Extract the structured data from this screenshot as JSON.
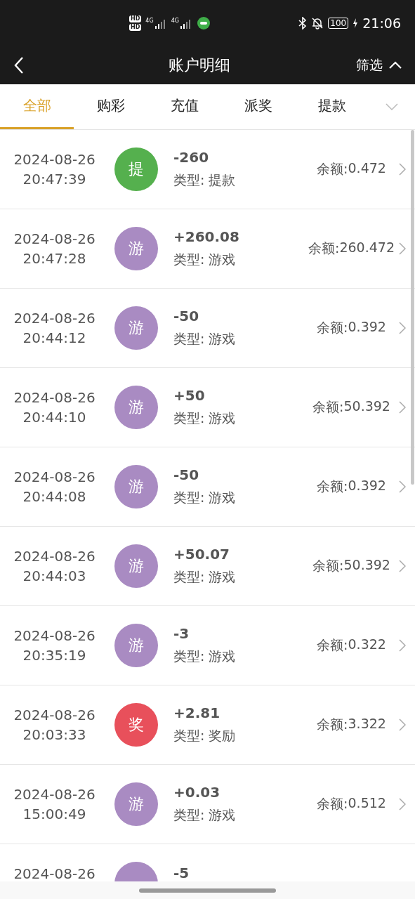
{
  "status_bar": {
    "sims": [
      "HD",
      "HD"
    ],
    "networks": [
      "4G",
      "4G"
    ],
    "battery": "100",
    "time": "21:06"
  },
  "header": {
    "title": "账户明细",
    "filter": "筛选",
    "filter_expanded": true
  },
  "tabs": [
    {
      "label": "全部",
      "selected": true
    },
    {
      "label": "购彩",
      "selected": false
    },
    {
      "label": "充值",
      "selected": false
    },
    {
      "label": "派奖",
      "selected": false
    },
    {
      "label": "提款",
      "selected": false
    }
  ],
  "records": [
    {
      "date": "2024-08-26",
      "time": "20:47:39",
      "badge": "提",
      "color": "#55b04e",
      "amount": "-260",
      "type": "类型: 提款",
      "balance_label": "余额:",
      "balance": "0.472"
    },
    {
      "date": "2024-08-26",
      "time": "20:47:28",
      "badge": "游",
      "color": "#a98bc2",
      "amount": "+260.08",
      "type": "类型: 游戏",
      "balance_label": "余额:",
      "balance": "260.472"
    },
    {
      "date": "2024-08-26",
      "time": "20:44:12",
      "badge": "游",
      "color": "#a98bc2",
      "amount": "-50",
      "type": "类型: 游戏",
      "balance_label": "余额:",
      "balance": "0.392"
    },
    {
      "date": "2024-08-26",
      "time": "20:44:10",
      "badge": "游",
      "color": "#a98bc2",
      "amount": "+50",
      "type": "类型: 游戏",
      "balance_label": "余额:",
      "balance": "50.392"
    },
    {
      "date": "2024-08-26",
      "time": "20:44:08",
      "badge": "游",
      "color": "#a98bc2",
      "amount": "-50",
      "type": "类型: 游戏",
      "balance_label": "余额:",
      "balance": "0.392"
    },
    {
      "date": "2024-08-26",
      "time": "20:44:03",
      "badge": "游",
      "color": "#a98bc2",
      "amount": "+50.07",
      "type": "类型: 游戏",
      "balance_label": "余额:",
      "balance": "50.392"
    },
    {
      "date": "2024-08-26",
      "time": "20:35:19",
      "badge": "游",
      "color": "#a98bc2",
      "amount": "-3",
      "type": "类型: 游戏",
      "balance_label": "余额:",
      "balance": "0.322"
    },
    {
      "date": "2024-08-26",
      "time": "20:03:33",
      "badge": "奖",
      "color": "#e8505b",
      "amount": "+2.81",
      "type": "类型: 奖励",
      "balance_label": "余额:",
      "balance": "3.322"
    },
    {
      "date": "2024-08-26",
      "time": "15:00:49",
      "badge": "游",
      "color": "#a98bc2",
      "amount": "+0.03",
      "type": "类型: 游戏",
      "balance_label": "余额:",
      "balance": "0.512"
    },
    {
      "date": "2024-08-26",
      "color": "#a98bc2",
      "amount": "-5"
    }
  ]
}
